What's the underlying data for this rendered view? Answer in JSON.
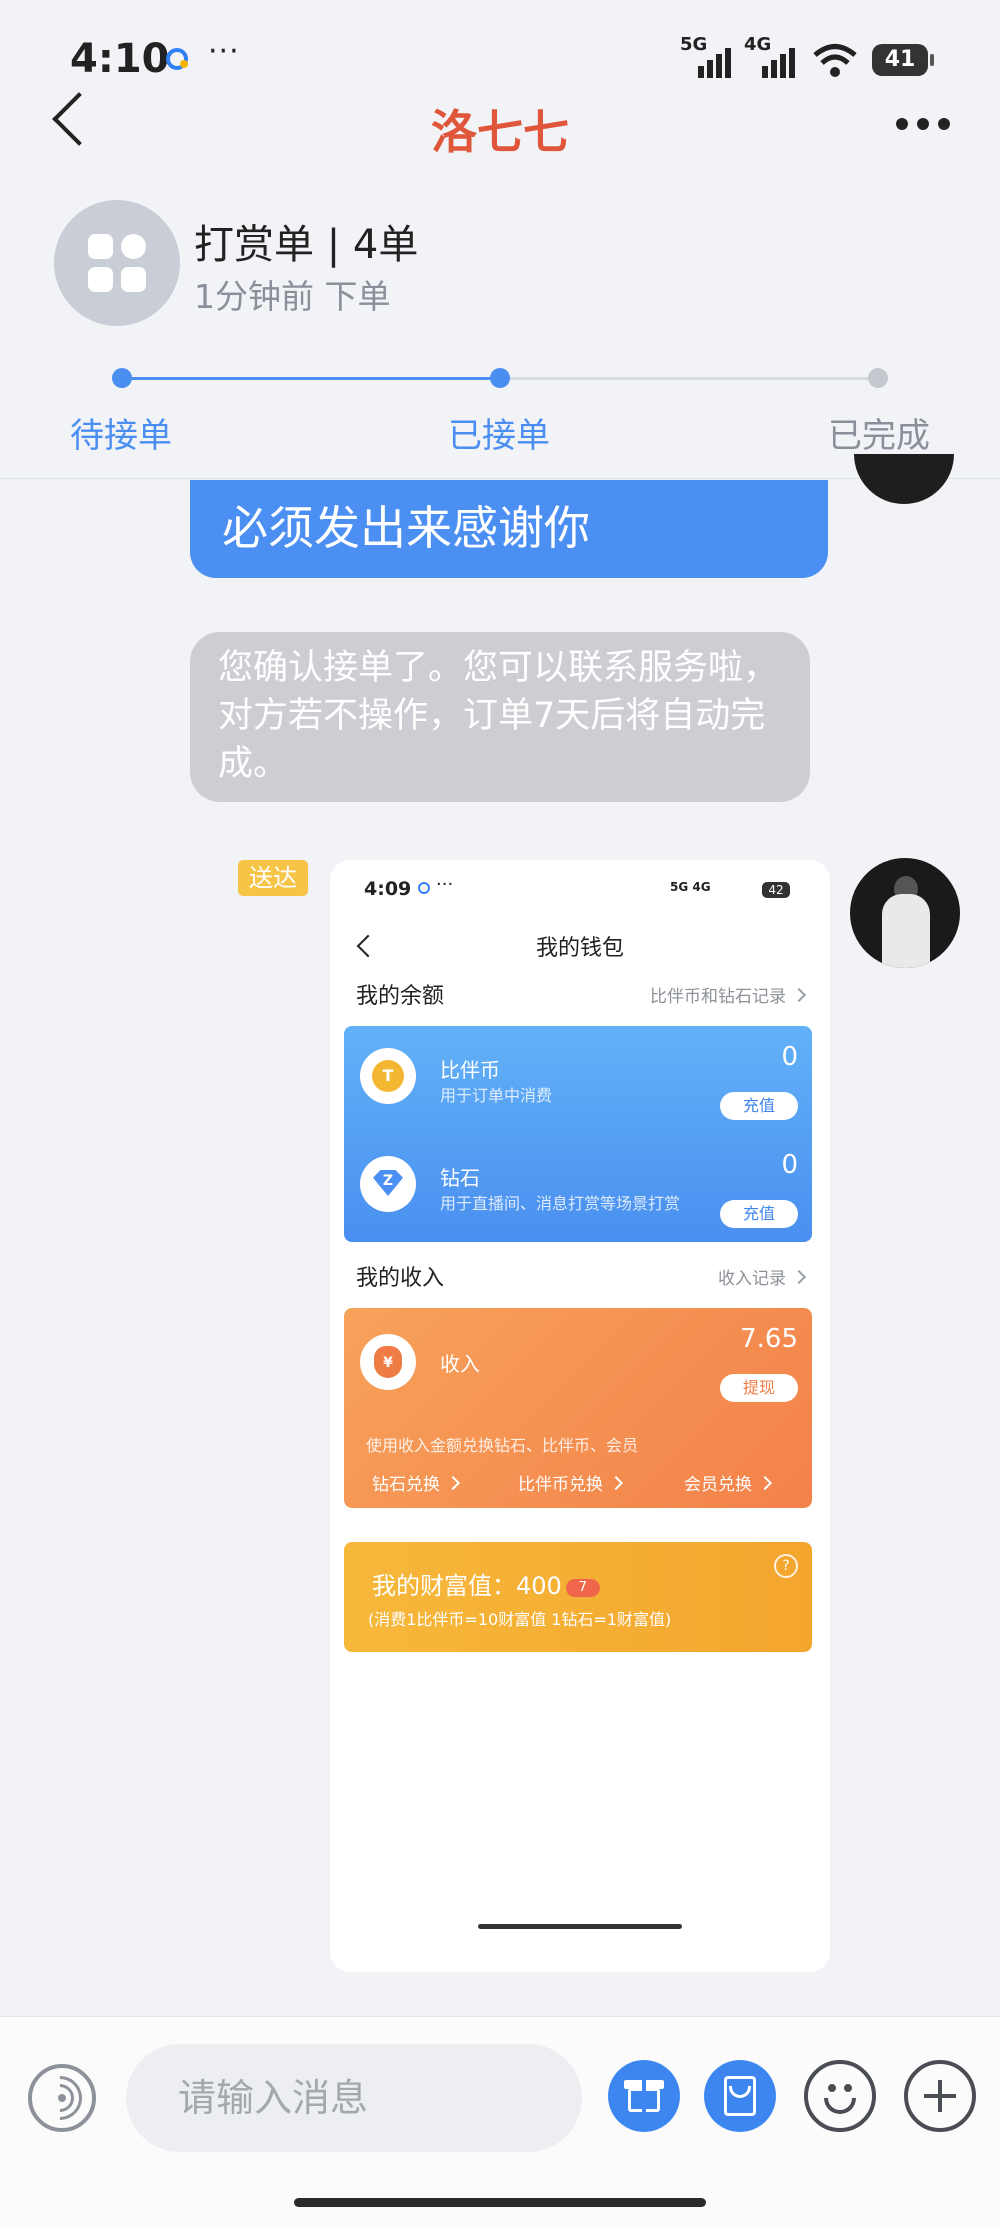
{
  "status_bar": {
    "time": "4:10",
    "extra": "···",
    "network_5g": "5G",
    "network_4g": "4G",
    "battery": "41"
  },
  "header": {
    "title": "洛七七",
    "title_color": "#e0563b"
  },
  "order": {
    "title": "打赏单 | 4单",
    "subtitle": "1分钟前 下单",
    "steps": [
      {
        "label": "待接单",
        "state": "done"
      },
      {
        "label": "已接单",
        "state": "current"
      },
      {
        "label": "已完成",
        "state": "pending"
      }
    ],
    "active_color": "#4a8ef2"
  },
  "chat": {
    "messages": [
      {
        "type": "text",
        "from": "self",
        "text": "必须发出来感谢你"
      },
      {
        "type": "system",
        "text": "您确认接单了。您可以联系服务啦，对方若不操作，订单7天后将自动完成。"
      },
      {
        "type": "image",
        "from": "self",
        "status": "送达"
      }
    ]
  },
  "shared_screenshot": {
    "status_time": "4:09",
    "status_extra": "···",
    "status_net": "5G 4G",
    "status_battery": "42",
    "title": "我的钱包",
    "balance_section": {
      "title": "我的余额",
      "link": "比伴币和钻石记录"
    },
    "coins": {
      "name": "比伴币",
      "desc": "用于订单中消费",
      "value": "0",
      "button": "充值",
      "icon_text": "T"
    },
    "diamonds": {
      "name": "钻石",
      "desc": "用于直播间、消息打赏等场景打赏",
      "value": "0",
      "button": "充值",
      "icon_text": "Z"
    },
    "income_section": {
      "title": "我的收入",
      "link": "收入记录"
    },
    "income": {
      "name": "收入",
      "value": "7.65",
      "button": "提现",
      "icon_text": "¥",
      "note": "使用收入金额兑换钻石、比伴币、会员",
      "links": [
        "钻石兑换",
        "比伴币兑换",
        "会员兑换"
      ]
    },
    "wealth": {
      "title": "我的财富值：400",
      "badge": "7",
      "note": "(消费1比伴币=10财富值 1钻石=1财富值)",
      "help": "?"
    }
  },
  "input_bar": {
    "placeholder": "请输入消息",
    "icons": [
      "voice-icon",
      "gift-icon",
      "red-packet-icon",
      "emoji-icon",
      "plus-icon"
    ]
  }
}
